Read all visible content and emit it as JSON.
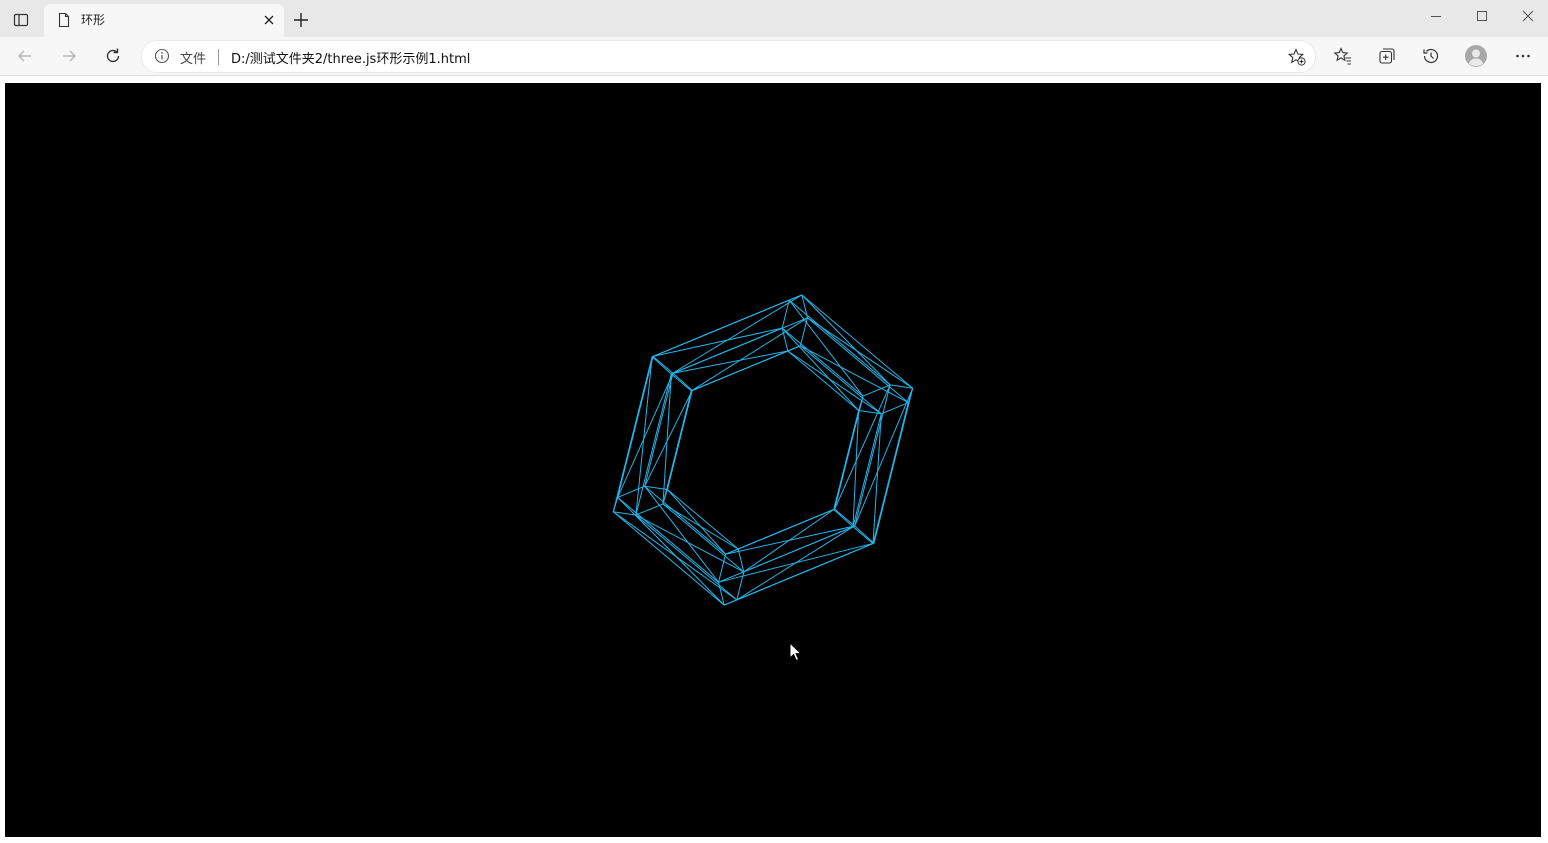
{
  "browser": {
    "tab": {
      "title": "环形",
      "favicon": "page-icon"
    },
    "address": {
      "scheme": "文件",
      "url": "D:/测试文件夹2/three.js环形示例1.html"
    }
  },
  "scene": {
    "wire_color": "#23b5e8",
    "background": "#000000",
    "object": "torus-wireframe",
    "radial_segments": 6,
    "tubular_segments": 6
  },
  "colors": {
    "titlebar": "#e8e8e8",
    "toolbar": "#f7f7f7"
  }
}
